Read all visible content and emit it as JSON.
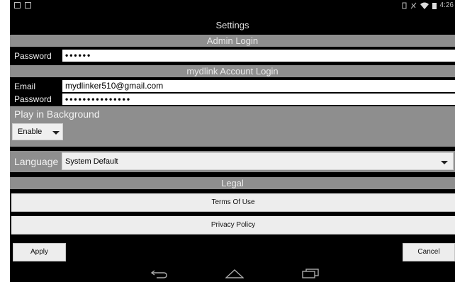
{
  "status_bar": {
    "time": "4:26"
  },
  "title": "Settings",
  "admin": {
    "header": "Admin Login",
    "password_label": "Password",
    "password_value": "••••••"
  },
  "mydlink": {
    "header": "mydlink Account Login",
    "email_label": "Email",
    "email_value": "mydlinker510@gmail.com",
    "password_label": "Password",
    "password_value": "•••••••••••••••"
  },
  "background": {
    "title": "Play in Background",
    "selected": "Enable"
  },
  "language": {
    "label": "Language",
    "selected": "System Default"
  },
  "legal": {
    "header": "Legal",
    "terms": "Terms Of Use",
    "privacy": "Privacy Policy"
  },
  "actions": {
    "apply": "Apply",
    "cancel": "Cancel"
  },
  "colors": {
    "section_gray": "#8e8e8e",
    "background": "#000000",
    "button": "#ededed"
  }
}
